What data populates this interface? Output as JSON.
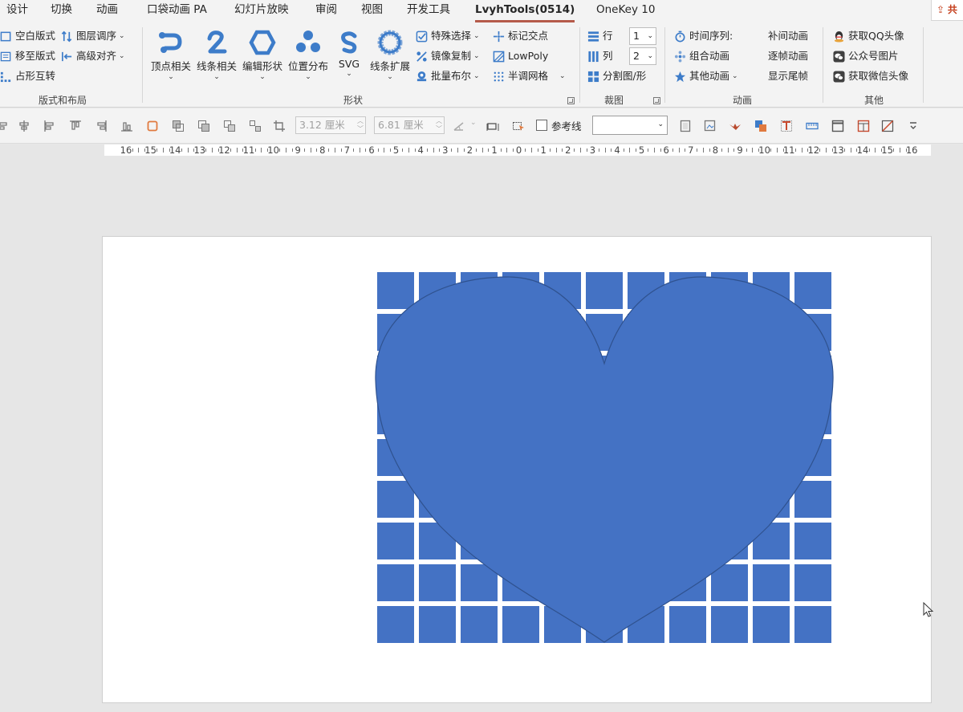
{
  "tabs": [
    {
      "label": "设计",
      "active": false
    },
    {
      "label": "切换",
      "active": false
    },
    {
      "label": "动画",
      "active": false
    },
    {
      "label": "口袋动画 PA",
      "active": false
    },
    {
      "label": "幻灯片放映",
      "active": false
    },
    {
      "label": "审阅",
      "active": false
    },
    {
      "label": "视图",
      "active": false
    },
    {
      "label": "开发工具",
      "active": false
    },
    {
      "label": "LvyhTools(0514)",
      "active": true
    },
    {
      "label": "OneKey 10",
      "active": false
    }
  ],
  "share": {
    "label": "共"
  },
  "ribbon": {
    "layout_group": {
      "label": "版式和布局",
      "items": [
        "空白版式",
        "移至版式",
        "占形互转",
        "图层调序",
        "高级对齐"
      ]
    },
    "shape_group": {
      "label": "形状",
      "big": [
        "顶点相关",
        "线条相关",
        "编辑形状",
        "位置分布",
        "SVG",
        "线条扩展"
      ],
      "small": [
        "特殊选择",
        "镜像复制",
        "批量布尔",
        "标记交点",
        "LowPoly",
        "半调网格"
      ]
    },
    "crop_group": {
      "label": "裁图",
      "row_label": "行",
      "row_value": "1",
      "col_label": "列",
      "col_value": "2",
      "split_label": "分割图/形"
    },
    "anim_group": {
      "label": "动画",
      "items": [
        "时间序列:",
        "组合动画",
        "其他动画",
        "补间动画",
        "逐帧动画",
        "显示尾帧"
      ]
    },
    "other_group": {
      "label": "其他",
      "items": [
        "获取QQ头像",
        "公众号图片",
        "获取微信头像"
      ]
    }
  },
  "toolbar": {
    "width_value": "3.12 厘米",
    "height_value": "6.81 厘米",
    "guide_label": "参考线",
    "guide_select_value": ""
  },
  "ruler": {
    "labels": [
      "16",
      "15",
      "14",
      "13",
      "12",
      "11",
      "10",
      "9",
      "8",
      "7",
      "6",
      "5",
      "4",
      "3",
      "2",
      "1",
      "0",
      "1",
      "2",
      "3",
      "4",
      "5",
      "6",
      "7",
      "8",
      "9",
      "10",
      "11",
      "12",
      "13",
      "14",
      "15",
      "16"
    ]
  },
  "slide": {
    "grid": {
      "rows": 9,
      "cols": 11
    },
    "colors": {
      "grid_fill": "#4472c4",
      "heart_fill": "#4472c4",
      "heart_stroke": "#2f528f"
    }
  },
  "colors": {
    "accent": "#b55a4a",
    "icon_blue": "#3d7cc9"
  }
}
